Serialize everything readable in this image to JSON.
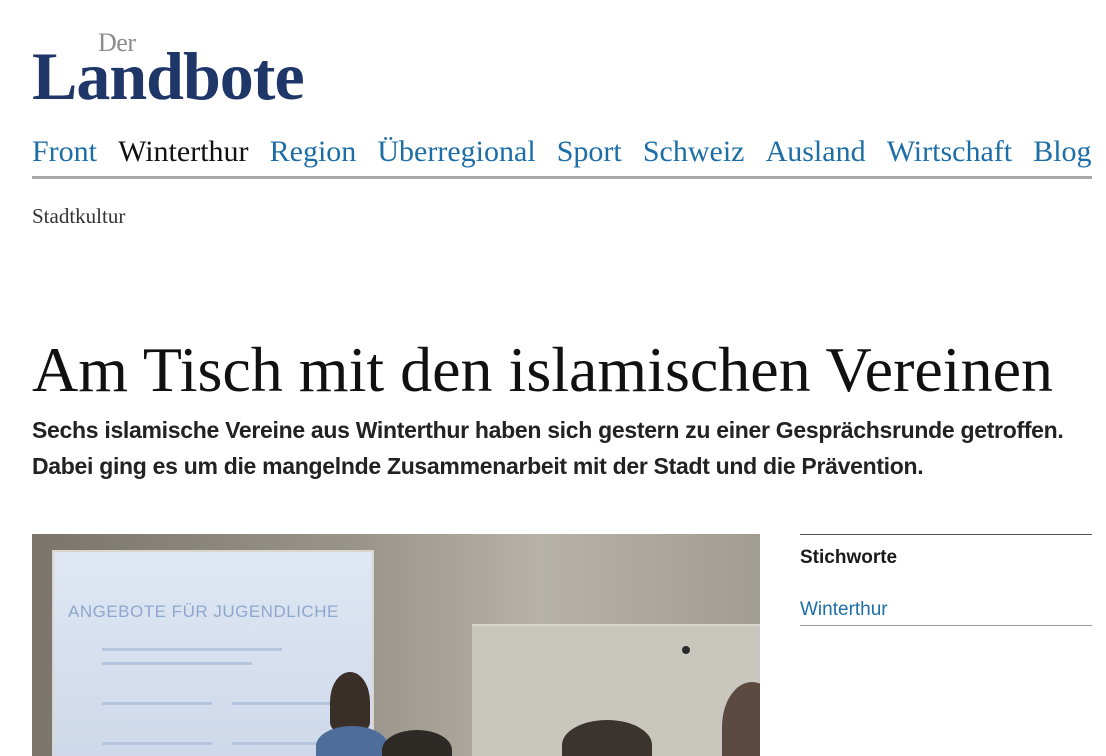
{
  "logo": {
    "small": "Der",
    "main": "Landbote"
  },
  "nav": {
    "items": [
      {
        "label": "Front",
        "active": false
      },
      {
        "label": "Winterthur",
        "active": true
      },
      {
        "label": "Region",
        "active": false
      },
      {
        "label": "Überregional",
        "active": false
      },
      {
        "label": "Sport",
        "active": false
      },
      {
        "label": "Schweiz",
        "active": false
      },
      {
        "label": "Ausland",
        "active": false
      },
      {
        "label": "Wirtschaft",
        "active": false
      },
      {
        "label": "Blogs/Le",
        "active": false
      }
    ]
  },
  "subnav": {
    "label": "Stadtkultur"
  },
  "article": {
    "headline": "Am Tisch mit den islamischen Vereinen",
    "lead": "Sechs islamische Vereine aus Winterthur haben sich gestern zu einer Gesprächsrunde getroffen. Dabei ging es um die mangelnde Zusammenarbeit mit der Stadt und die Prävention.",
    "photo": {
      "screen_title": "ANGEBOTE FÜR JUGENDLICHE"
    }
  },
  "sidebar": {
    "title": "Stichworte",
    "tags": [
      "Winterthur"
    ]
  },
  "colors": {
    "brand": "#1e3668",
    "link": "#1d6ea6",
    "rule": "#a8a8a8"
  }
}
